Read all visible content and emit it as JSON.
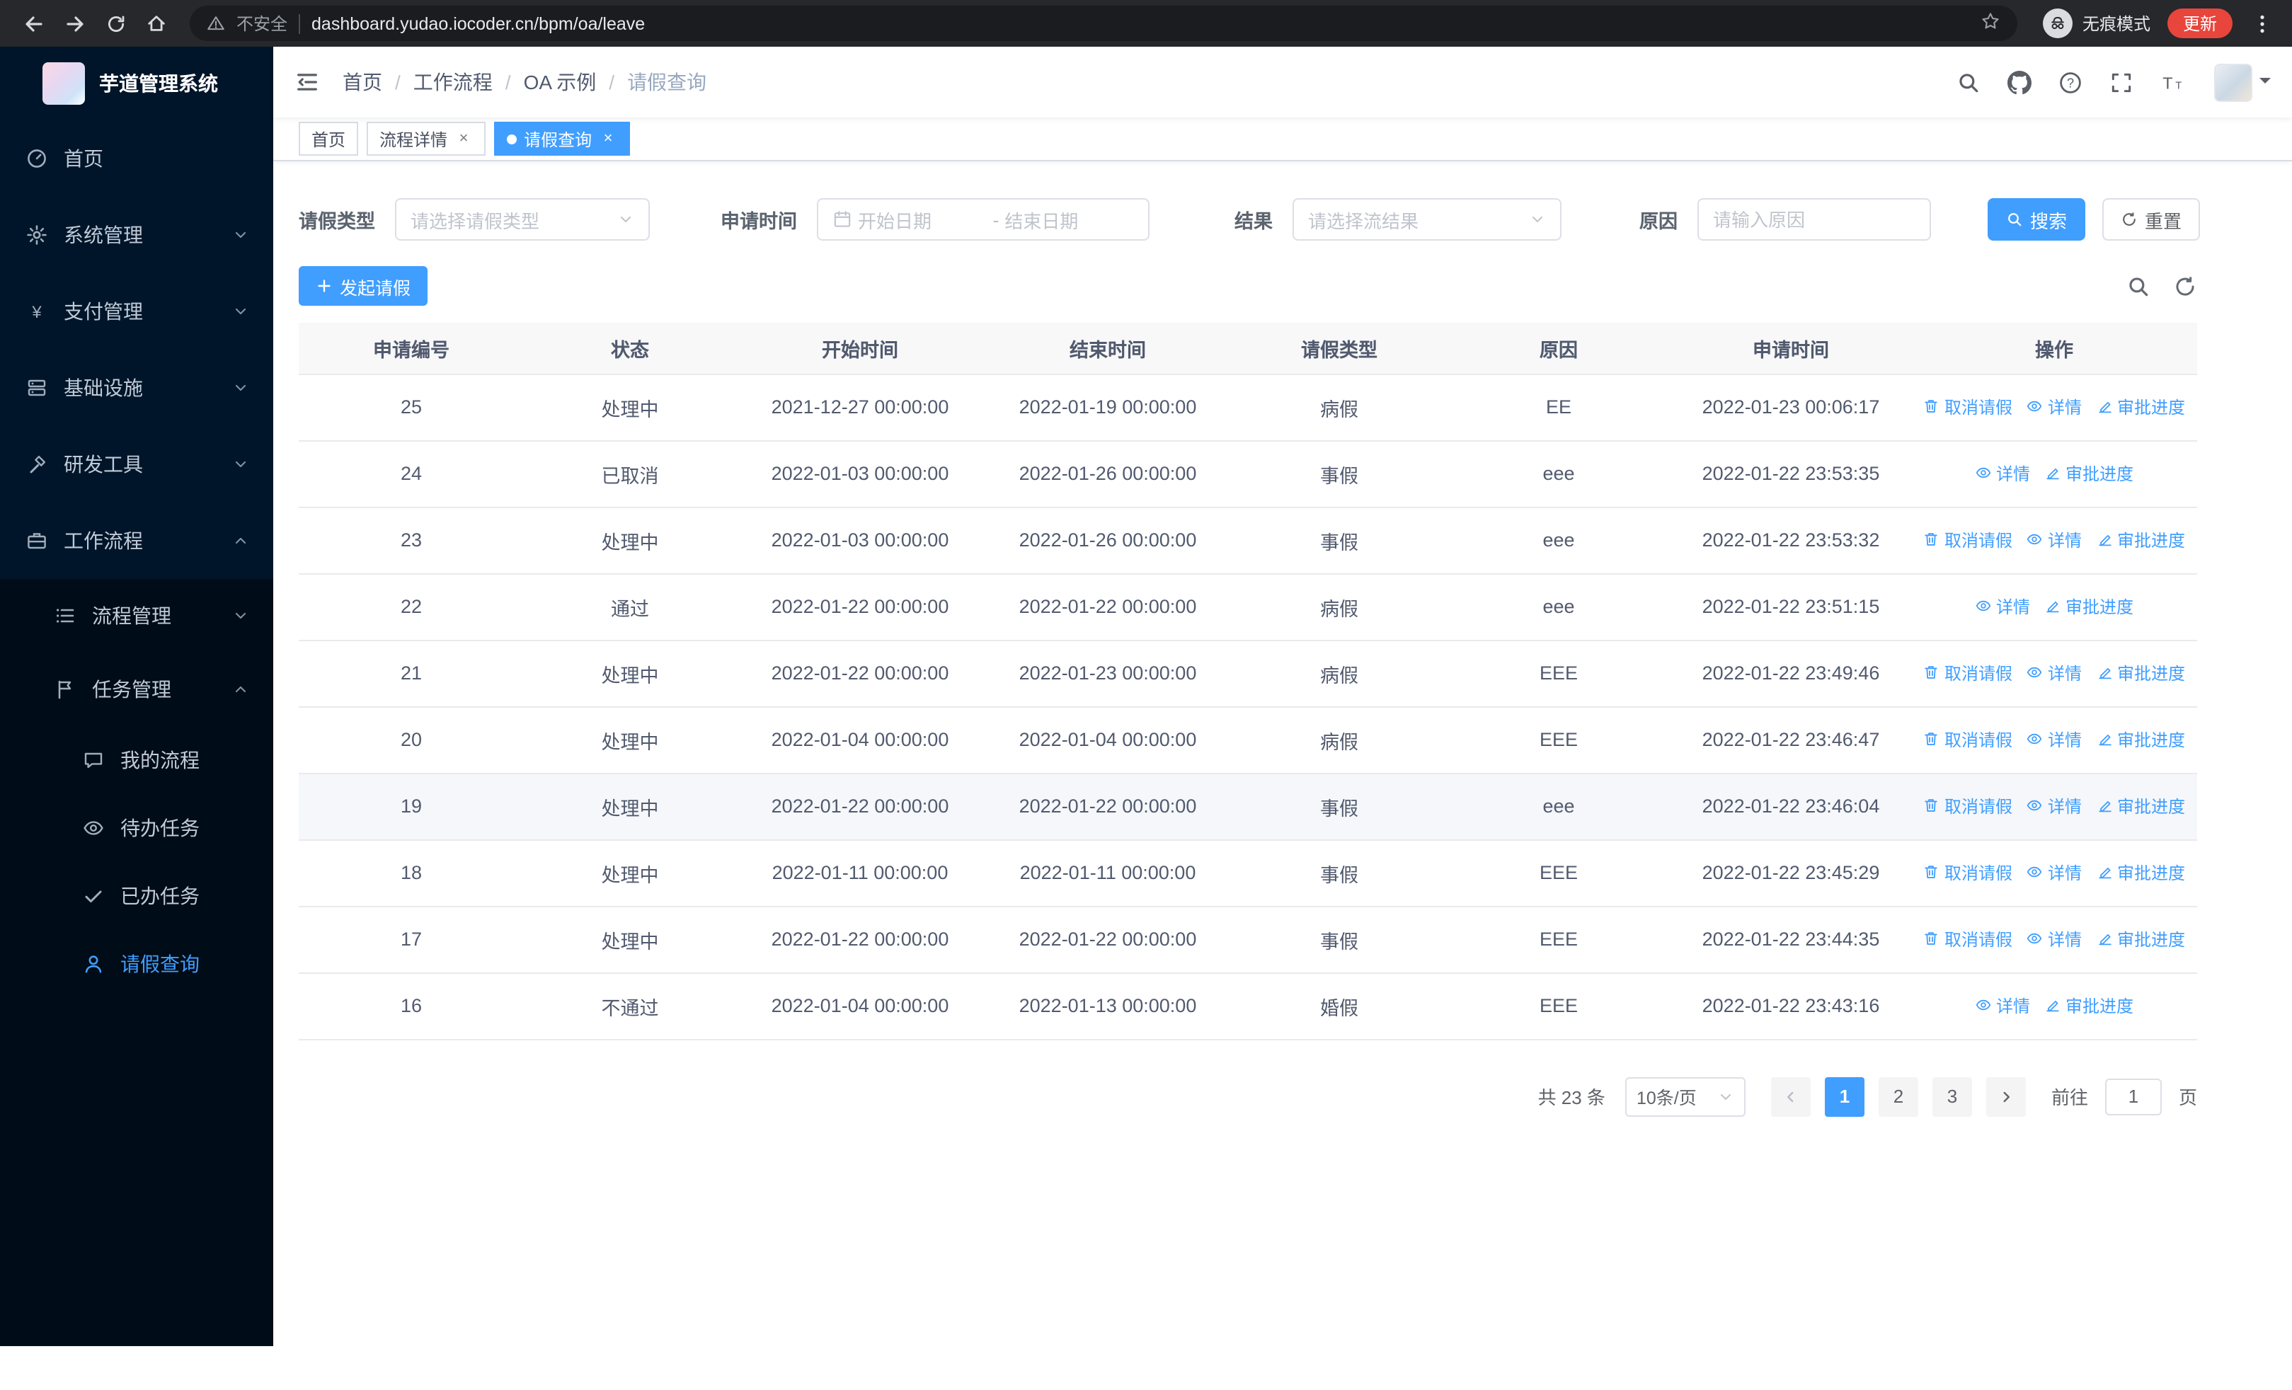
{
  "colors": {
    "accent": "#409eff",
    "sidebar_bg": "#001529",
    "update_button": "#e8453c"
  },
  "ui": {
    "slash": "/",
    "close_glyph": "×"
  },
  "browser": {
    "security_label": "不安全",
    "url": "dashboard.yudao.iocoder.cn/bpm/oa/leave",
    "incognito_label": "无痕模式",
    "update_label": "更新"
  },
  "sidebar": {
    "app_title": "芋道管理系统",
    "items": [
      {
        "label": "首页"
      },
      {
        "label": "系统管理"
      },
      {
        "label": "支付管理"
      },
      {
        "label": "基础设施"
      },
      {
        "label": "研发工具"
      },
      {
        "label": "工作流程"
      }
    ],
    "submenu": [
      {
        "label": "流程管理"
      },
      {
        "label": "任务管理"
      }
    ],
    "task_items": [
      {
        "label": "我的流程"
      },
      {
        "label": "待办任务"
      },
      {
        "label": "已办任务"
      },
      {
        "label": "请假查询",
        "active": true
      }
    ]
  },
  "header": {
    "breadcrumb": [
      "首页",
      "工作流程",
      "OA 示例",
      "请假查询"
    ]
  },
  "tabs": [
    {
      "label": "首页",
      "closable": false,
      "active": false
    },
    {
      "label": "流程详情",
      "closable": true,
      "active": false
    },
    {
      "label": "请假查询",
      "closable": true,
      "active": true
    }
  ],
  "filters": {
    "leave_type_label": "请假类型",
    "leave_type_placeholder": "请选择请假类型",
    "apply_time_label": "申请时间",
    "start_date_placeholder": "开始日期",
    "range_separator": "-",
    "end_date_placeholder": "结束日期",
    "result_label": "结果",
    "result_placeholder": "请选择流结果",
    "reason_label": "原因",
    "reason_placeholder": "请输入原因",
    "search_button": "搜索",
    "reset_button": "重置"
  },
  "toolbar": {
    "create_button": "发起请假"
  },
  "table": {
    "columns": [
      "申请编号",
      "状态",
      "开始时间",
      "结束时间",
      "请假类型",
      "原因",
      "申请时间",
      "操作"
    ],
    "rows": [
      {
        "id": "25",
        "status": "处理中",
        "start": "2021-12-27 00:00:00",
        "end": "2022-01-19 00:00:00",
        "type": "病假",
        "reason": "EE",
        "applied": "2022-01-23 00:06:17",
        "actions": [
          "取消请假",
          "详情",
          "审批进度"
        ]
      },
      {
        "id": "24",
        "status": "已取消",
        "start": "2022-01-03 00:00:00",
        "end": "2022-01-26 00:00:00",
        "type": "事假",
        "reason": "eee",
        "applied": "2022-01-22 23:53:35",
        "actions": [
          "详情",
          "审批进度"
        ]
      },
      {
        "id": "23",
        "status": "处理中",
        "start": "2022-01-03 00:00:00",
        "end": "2022-01-26 00:00:00",
        "type": "事假",
        "reason": "eee",
        "applied": "2022-01-22 23:53:32",
        "actions": [
          "取消请假",
          "详情",
          "审批进度"
        ]
      },
      {
        "id": "22",
        "status": "通过",
        "start": "2022-01-22 00:00:00",
        "end": "2022-01-22 00:00:00",
        "type": "病假",
        "reason": "eee",
        "applied": "2022-01-22 23:51:15",
        "actions": [
          "详情",
          "审批进度"
        ]
      },
      {
        "id": "21",
        "status": "处理中",
        "start": "2022-01-22 00:00:00",
        "end": "2022-01-23 00:00:00",
        "type": "病假",
        "reason": "EEE",
        "applied": "2022-01-22 23:49:46",
        "actions": [
          "取消请假",
          "详情",
          "审批进度"
        ]
      },
      {
        "id": "20",
        "status": "处理中",
        "start": "2022-01-04 00:00:00",
        "end": "2022-01-04 00:00:00",
        "type": "病假",
        "reason": "EEE",
        "applied": "2022-01-22 23:46:47",
        "actions": [
          "取消请假",
          "详情",
          "审批进度"
        ]
      },
      {
        "id": "19",
        "status": "处理中",
        "start": "2022-01-22 00:00:00",
        "end": "2022-01-22 00:00:00",
        "type": "事假",
        "reason": "eee",
        "applied": "2022-01-22 23:46:04",
        "actions": [
          "取消请假",
          "详情",
          "审批进度"
        ],
        "highlighted": true
      },
      {
        "id": "18",
        "status": "处理中",
        "start": "2022-01-11 00:00:00",
        "end": "2022-01-11 00:00:00",
        "type": "事假",
        "reason": "EEE",
        "applied": "2022-01-22 23:45:29",
        "actions": [
          "取消请假",
          "详情",
          "审批进度"
        ]
      },
      {
        "id": "17",
        "status": "处理中",
        "start": "2022-01-22 00:00:00",
        "end": "2022-01-22 00:00:00",
        "type": "事假",
        "reason": "EEE",
        "applied": "2022-01-22 23:44:35",
        "actions": [
          "取消请假",
          "详情",
          "审批进度"
        ]
      },
      {
        "id": "16",
        "status": "不通过",
        "start": "2022-01-04 00:00:00",
        "end": "2022-01-13 00:00:00",
        "type": "婚假",
        "reason": "EEE",
        "applied": "2022-01-22 23:43:16",
        "actions": [
          "详情",
          "审批进度"
        ]
      }
    ]
  },
  "pagination": {
    "total": "共 23 条",
    "page_size": "10条/页",
    "pages": [
      "1",
      "2",
      "3"
    ],
    "current_page": "1",
    "goto_label": "前往",
    "goto_value": "1",
    "goto_suffix": "页"
  }
}
